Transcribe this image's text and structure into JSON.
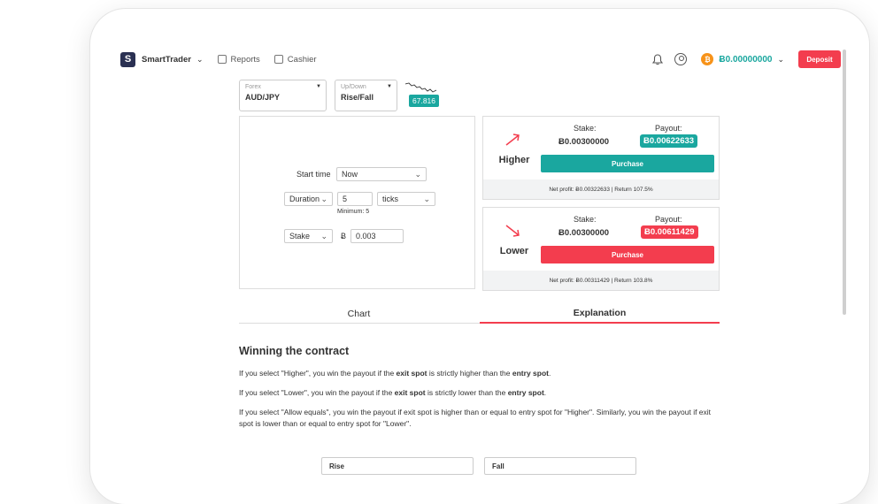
{
  "header": {
    "logo_letter": "S",
    "brand": "SmartTrader",
    "nav": [
      {
        "label": "Reports",
        "icon": "reports-icon"
      },
      {
        "label": "Cashier",
        "icon": "cashier-icon"
      }
    ],
    "balance": "Ƀ0.00000000",
    "coin_symbol": "₿",
    "deposit_label": "Deposit"
  },
  "selectors": {
    "market": {
      "label": "Forex",
      "value": "AUD/JPY"
    },
    "trade_type": {
      "label": "Up/Down",
      "value": "Rise/Fall"
    },
    "spot": "67.816"
  },
  "form": {
    "start_time_label": "Start time",
    "start_time_value": "Now",
    "duration_label": "Duration",
    "duration_value": "5",
    "duration_unit": "ticks",
    "minimum_note": "Minimum: 5",
    "stake_label": "Stake",
    "currency_symbol": "Ƀ",
    "stake_value": "0.003"
  },
  "contracts": [
    {
      "title": "Higher",
      "stake_label": "Stake:",
      "stake": "Ƀ0.00300000",
      "payout_label": "Payout:",
      "payout": "Ƀ0.00622633",
      "purchase_label": "Purchase",
      "net_profit": "Net profit: Ƀ0.00322633 | Return 107.5%",
      "color": "#1aa79f"
    },
    {
      "title": "Lower",
      "stake_label": "Stake:",
      "stake": "Ƀ0.00300000",
      "payout_label": "Payout:",
      "payout": "Ƀ0.00611429",
      "purchase_label": "Purchase",
      "net_profit": "Net profit: Ƀ0.00311429 | Return 103.8%",
      "color": "#f33d4e"
    }
  ],
  "tabs": [
    {
      "label": "Chart"
    },
    {
      "label": "Explanation"
    }
  ],
  "explanation": {
    "heading": "Winning the contract",
    "p1": {
      "a": "If you select \"Higher\", you win the payout if the ",
      "b": "exit spot",
      "c": " is strictly higher than the ",
      "d": "entry spot",
      "e": "."
    },
    "p2": {
      "a": "If you select \"Lower\", you win the payout if the ",
      "b": "exit spot",
      "c": " is strictly lower than the ",
      "d": "entry spot",
      "e": "."
    },
    "p3": "If you select \"Allow equals\", you win the payout if exit spot is higher than or equal to entry spot for \"Higher\". Similarly, you win the payout if exit spot is lower than or equal to entry spot for \"Lower\"."
  },
  "bottom": {
    "left": "Rise",
    "right": "Fall"
  }
}
